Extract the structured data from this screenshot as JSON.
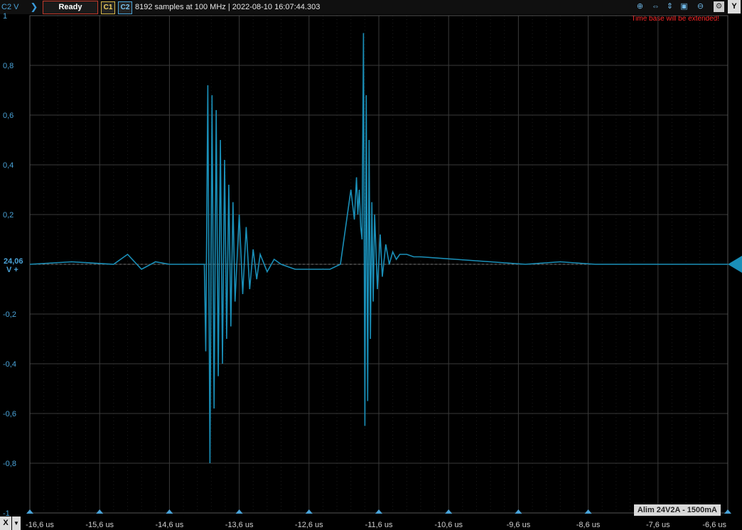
{
  "toolbar": {
    "channel_unit": "C2 V",
    "status": "Ready",
    "channels": [
      "C1",
      "C2"
    ],
    "acquisition_info": "8192 samples at 100 MHz | 2022-08-10 16:07:44.303",
    "warning": "Time base will be extended!",
    "y_button": "Y",
    "x_button": "X",
    "icons": [
      "zoom-in-icon",
      "zoom-x-icon",
      "zoom-y-icon",
      "zoom-box-icon",
      "zoom-out-icon",
      "settings-icon"
    ]
  },
  "offset_label": {
    "value": "24,06",
    "unit": "V +"
  },
  "instrument_label": "Alim 24V2A - 1500mA",
  "colors": {
    "trace": "#1a8fb8",
    "axis_text": "#4aa3d8",
    "grid": "#3a3a3a",
    "warning": "#ff2a2a"
  },
  "chart_data": {
    "type": "line",
    "title": "",
    "xlabel": "",
    "ylabel": "",
    "xlim": [
      -16.6,
      -6.6
    ],
    "ylim": [
      -1,
      1
    ],
    "x_ticks": [
      "-16,6 us",
      "-15,6 us",
      "-14,6 us",
      "-13,6 us",
      "-12,6 us",
      "-11,6 us",
      "-10,6 us",
      "-9,6 us",
      "-8,6 us",
      "-7,6 us",
      "-6,6 us"
    ],
    "y_ticks": [
      "1",
      "0,8",
      "0,6",
      "0,4",
      "0,2",
      "-0,2",
      "-0,4",
      "-0,6",
      "-0,8",
      "-1"
    ],
    "grid": true,
    "series": [
      {
        "x": [
          -16.6,
          -16.0,
          -15.4,
          -15.2,
          -15.0,
          -14.8,
          -14.6,
          -14.3,
          -14.1,
          -14.08,
          -14.05,
          -14.02,
          -13.99,
          -13.96,
          -13.93,
          -13.9,
          -13.87,
          -13.84,
          -13.81,
          -13.78,
          -13.75,
          -13.72,
          -13.69,
          -13.66,
          -13.6,
          -13.55,
          -13.5,
          -13.45,
          -13.4,
          -13.35,
          -13.3,
          -13.2,
          -13.1,
          -13.0,
          -12.8,
          -12.6,
          -12.3,
          -12.15,
          -12.0,
          -11.95,
          -11.92,
          -11.9,
          -11.88,
          -11.86,
          -11.84,
          -11.82,
          -11.8,
          -11.78,
          -11.76,
          -11.74,
          -11.72,
          -11.7,
          -11.68,
          -11.66,
          -11.62,
          -11.58,
          -11.55,
          -11.5,
          -11.45,
          -11.4,
          -11.35,
          -11.3,
          -11.2,
          -11.1,
          -11.0,
          -10.5,
          -10.0,
          -9.5,
          -9.0,
          -8.5,
          -8.0,
          -7.5,
          -7.0,
          -6.6
        ],
        "y": [
          0.0,
          0.01,
          0.0,
          0.04,
          -0.02,
          0.01,
          0.0,
          0.0,
          0.0,
          -0.35,
          0.72,
          -0.8,
          0.68,
          -0.58,
          0.62,
          -0.45,
          0.5,
          -0.4,
          0.42,
          -0.3,
          0.32,
          -0.25,
          0.25,
          -0.15,
          0.2,
          -0.12,
          0.15,
          -0.1,
          0.06,
          -0.06,
          0.04,
          -0.03,
          0.02,
          0.0,
          -0.02,
          -0.02,
          -0.02,
          0.0,
          0.3,
          0.18,
          0.35,
          0.2,
          0.3,
          0.15,
          0.1,
          0.93,
          -0.65,
          0.68,
          -0.55,
          0.5,
          -0.3,
          0.25,
          -0.15,
          0.2,
          -0.1,
          0.12,
          -0.05,
          0.08,
          0.0,
          0.05,
          0.02,
          0.04,
          0.04,
          0.03,
          0.03,
          0.02,
          0.01,
          0.0,
          0.01,
          0.0,
          0.0,
          0.0,
          0.0,
          0.0
        ]
      }
    ]
  }
}
